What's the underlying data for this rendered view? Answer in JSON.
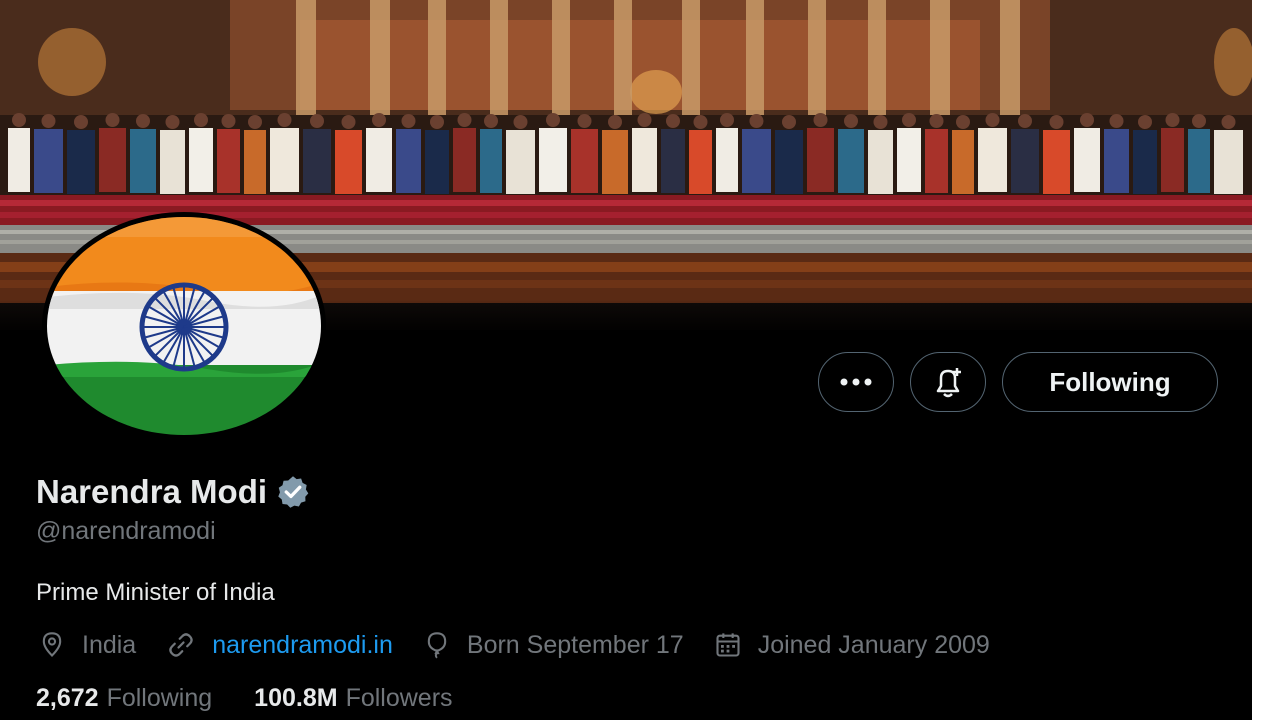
{
  "profile": {
    "name": "Narendra Modi",
    "handle": "@narendramodi",
    "verified": true,
    "bio": "Prime Minister of India",
    "avatar": "indian-flag",
    "banner": "group-photo-ceremony"
  },
  "actions": {
    "more_icon": "more-dots-icon",
    "notify_icon": "bell-plus-icon",
    "following_label": "Following"
  },
  "meta": {
    "location": "India",
    "website": "narendramodi.in",
    "birthday": "Born September 17",
    "joined": "Joined January 2009"
  },
  "stats": {
    "following_count": "2,672",
    "following_label": "Following",
    "followers_count": "100.8M",
    "followers_label": "Followers"
  },
  "colors": {
    "accent": "#1d9bf0",
    "muted": "#71767b",
    "text": "#e7e9ea",
    "verified": "#829aab"
  }
}
